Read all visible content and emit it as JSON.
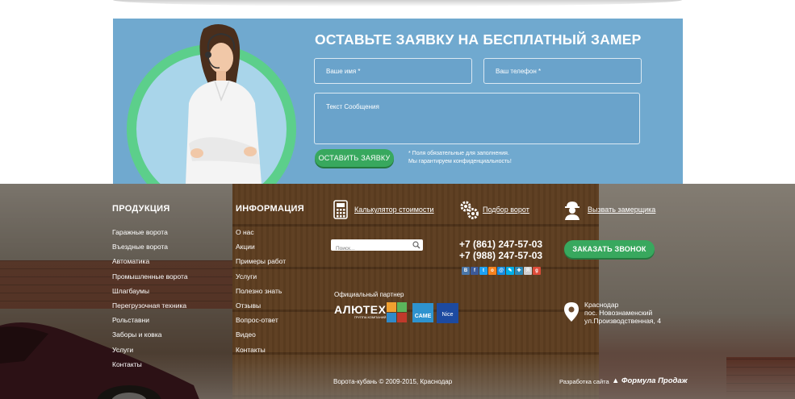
{
  "form": {
    "title": "ОСТАВЬТЕ ЗАЯВКУ НА БЕСПЛАТНЫЙ ЗАМЕР",
    "name_placeholder": "Ваше имя *",
    "phone_placeholder": "Ваш телефон *",
    "message_placeholder": "Текст Сообщения",
    "submit_label": "ОСТАВИТЬ ЗАЯВКУ",
    "note_line1": "* Поля обязательные для заполнения.",
    "note_line2": "Мы гарантируем конфиденциальность!"
  },
  "footer": {
    "products": {
      "title": "ПРОДУКЦИЯ",
      "items": [
        "Гаражные ворота",
        "Въездные ворота",
        "Автоматика",
        "Промышленные ворота",
        "Шлагбаумы",
        "Перегрузочная техника",
        "Рольставни",
        "Заборы и ковка",
        "Услуги",
        "Контакты"
      ]
    },
    "info": {
      "title": "ИНФОРМАЦИЯ",
      "items": [
        "О нас",
        "Акции",
        "Примеры работ",
        "Услуги",
        "Полезно знать",
        "Отзывы",
        "Вопрос-ответ",
        "Видео",
        "Контакты"
      ]
    },
    "calculator_link": "Калькулятор стоимости",
    "gate_selection_link": "Подбор ворот",
    "measurer_link": "Вызвать замерщика",
    "search_placeholder": "Поиск...",
    "phone1": "+7 (861) 247-57-03",
    "phone2": "+7 (988) 247-57-03",
    "call_button": "ЗАКАЗАТЬ ЗВОНОК",
    "partner_label": "Официальный партнер",
    "partners": {
      "alutech": "АЛЮТЕХ",
      "alutech_sub": "ГРУППА КОМПАНИЙ",
      "came": "CAME",
      "nice": "Nice"
    },
    "address_line1": "Краснодар",
    "address_line2": "пос. Новознаменский",
    "address_line3": "ул.Производственная, 4",
    "copyright": "Ворота-кубань © 2009-2015, Краснодар",
    "developer_label": "Разработка сайта",
    "developer_name": "Формула Продаж",
    "social_icons": [
      {
        "icon": "vk-icon",
        "glyph": "В",
        "color": "#4a76a8"
      },
      {
        "icon": "facebook-icon",
        "glyph": "f",
        "color": "#3b5998"
      },
      {
        "icon": "twitter-icon",
        "glyph": "t",
        "color": "#1da1f2"
      },
      {
        "icon": "odnoklassniki-icon",
        "glyph": "о",
        "color": "#f58220"
      },
      {
        "icon": "moimir-icon",
        "glyph": "@",
        "color": "#168de2"
      },
      {
        "icon": "livejournal-icon",
        "glyph": "✎",
        "color": "#00b0ea"
      },
      {
        "icon": "liveinternet-icon",
        "glyph": "✚",
        "color": "#2c8ab8"
      },
      {
        "icon": "yandex-icon",
        "glyph": "Я",
        "color": "#d0d0d0"
      },
      {
        "icon": "googleplus-icon",
        "glyph": "g",
        "color": "#dd4b39"
      }
    ]
  }
}
